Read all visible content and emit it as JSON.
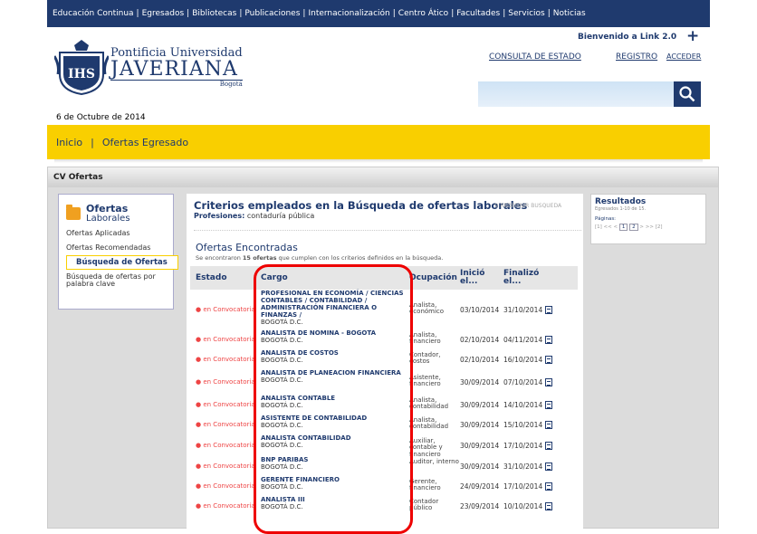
{
  "topnav": [
    "Educación Continua",
    "Egresados",
    "Bibliotecas",
    "Publicaciones",
    "Internacionalización",
    "Centro Ático",
    "Facultades",
    "Servicios",
    "Noticias"
  ],
  "logo": {
    "line1": "Pontificia Universidad",
    "line2": "JAVERIANA",
    "line3": "Bogotá"
  },
  "header": {
    "welcome": "Bienvenido a Link 2.0",
    "plus": "+",
    "consulta": "CONSULTA DE ESTADO",
    "registro": "REGISTRO",
    "acceder": "ACCEDER"
  },
  "search": {
    "placeholder": ""
  },
  "date": "6 de Octubre de 2014",
  "breadcrumb": {
    "inicio": "Inicio",
    "ofertas": "Ofertas Egresado"
  },
  "section_title": "CV Ofertas",
  "leftmenu": {
    "title_a": "Ofertas",
    "title_b": "Laborales",
    "items": [
      "Ofertas Aplicadas",
      "Ofertas Recomendadas",
      "Búsqueda de Ofertas",
      "Búsqueda de ofertas por palabra clave"
    ]
  },
  "criteria": {
    "title": "Criterios empleados en la Búsqueda de ofertas laborales",
    "redefine": "REDEFINIR BUSQUEDA",
    "prof_label": "Profesiones:",
    "prof_value": "contaduría pública"
  },
  "found": {
    "title": "Ofertas Encontradas",
    "subtitle_pre": "Se encontraron",
    "count": "15 ofertas",
    "subtitle_post": "que cumplen con los criterios definidos en la búsqueda."
  },
  "table": {
    "headers": {
      "estado": "Estado",
      "cargo": "Cargo",
      "ocupacion": "Ocupación",
      "inicio": "Inició el...",
      "finalizo": "Finalizó el..."
    },
    "rows": [
      {
        "estado": "en Convocatoria",
        "cargo": "PROFESIONAL EN ECONOMÍA / CIENCIAS CONTABLES / CONTABILIDAD / ADMINISTRACIÓN FINANCIERA O FINANZAS /",
        "ciudad": "BOGOTÁ D.C.",
        "ocupacion": "Analista, económico",
        "inicio": "03/10/2014",
        "fin": "31/10/2014"
      },
      {
        "estado": "en Convocatoria",
        "cargo": "ANALISTA DE NOMINA - BOGOTA",
        "ciudad": "BOGOTÁ D.C.",
        "ocupacion": "Analista, financiero",
        "inicio": "02/10/2014",
        "fin": "04/11/2014"
      },
      {
        "estado": "en Convocatoria",
        "cargo": "ANALISTA DE COSTOS",
        "ciudad": "BOGOTÁ D.C.",
        "ocupacion": "Contador, costos",
        "inicio": "02/10/2014",
        "fin": "16/10/2014"
      },
      {
        "estado": "en Convocatoria",
        "cargo": "ANALISTA DE PLANEACION FINANCIERA",
        "ciudad": "BOGOTÁ D.C.",
        "ocupacion": "Asistente, financiero",
        "inicio": "30/09/2014",
        "fin": "07/10/2014"
      },
      {
        "estado": "en Convocatoria",
        "cargo": "ANALISTA CONTABLE",
        "ciudad": "BOGOTÁ D.C.",
        "ocupacion": "Analista, contabilidad",
        "inicio": "30/09/2014",
        "fin": "14/10/2014"
      },
      {
        "estado": "en Convocatoria",
        "cargo": "ASISTENTE DE CONTABILIDAD",
        "ciudad": "BOGOTÁ D.C.",
        "ocupacion": "Analista, contabilidad",
        "inicio": "30/09/2014",
        "fin": "15/10/2014"
      },
      {
        "estado": "en Convocatoria",
        "cargo": "ANALISTA CONTABILIDAD",
        "ciudad": "BOGOTÁ D.C.",
        "ocupacion": "Auxiliar, contable y financiero",
        "inicio": "30/09/2014",
        "fin": "17/10/2014"
      },
      {
        "estado": "en Convocatoria",
        "cargo": "BNP PARIBAS",
        "ciudad": "BOGOTÁ D.C.",
        "ocupacion": "Auditor, interno",
        "inicio": "30/09/2014",
        "fin": "31/10/2014"
      },
      {
        "estado": "en Convocatoria",
        "cargo": "GERENTE FINANCIERO",
        "ciudad": "BOGOTÁ D.C.",
        "ocupacion": "Gerente, financiero",
        "inicio": "24/09/2014",
        "fin": "17/10/2014"
      },
      {
        "estado": "en Convocatoria",
        "cargo": "ANALISTA III",
        "ciudad": "BOGOTÁ D.C.",
        "ocupacion": "Contador público",
        "inicio": "23/09/2014",
        "fin": "10/10/2014"
      }
    ]
  },
  "results": {
    "title": "Resultados",
    "sub": "Egresados 1-10 de 15.",
    "paginas": "Páginas:",
    "pages_pre": "[1] << <",
    "page1": "1",
    "page2": "2",
    "pages_post": "> >> [2]"
  },
  "colors": {
    "navy": "#1f3a6e",
    "yellow": "#f9cf00",
    "annotation": "#e00000"
  }
}
